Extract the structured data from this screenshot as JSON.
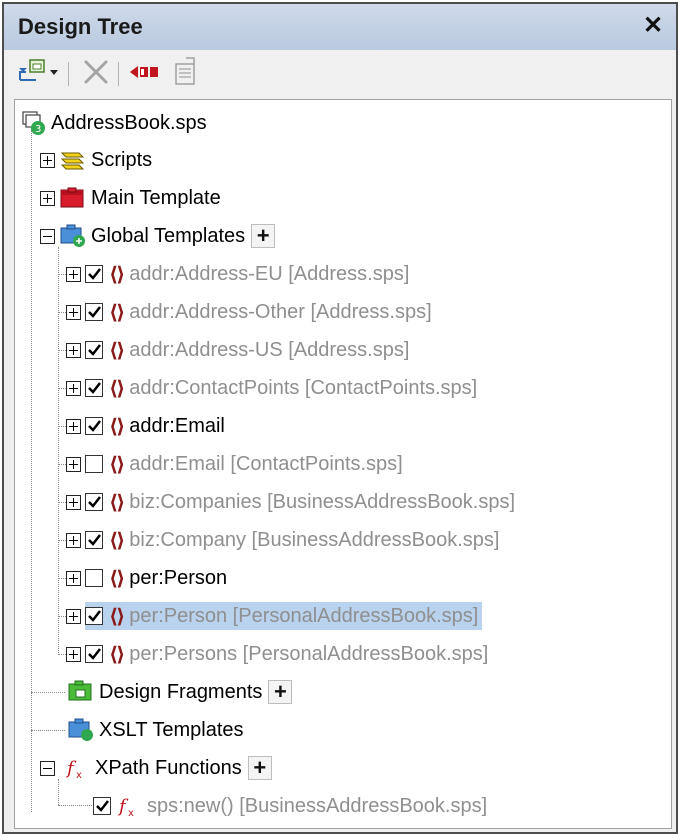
{
  "panel": {
    "title": "Design Tree",
    "close_glyph": "✕"
  },
  "toolbar": {
    "buttons": [
      {
        "name": "add-item-dropdown-button",
        "icon": "add-item-icon"
      },
      {
        "name": "delete-button",
        "icon": "delete-icon"
      },
      {
        "name": "toggle-button",
        "icon": "toggle-icon"
      },
      {
        "name": "properties-button",
        "icon": "properties-icon"
      }
    ]
  },
  "tree": {
    "root": {
      "label": "AddressBook.sps"
    },
    "scripts": {
      "label": "Scripts"
    },
    "main_template": {
      "label": "Main Template"
    },
    "global_templates": {
      "label": "Global Templates",
      "add_glyph": "+",
      "items": [
        {
          "label": "addr:Address-EU [Address.sps]",
          "checked": true,
          "active": false
        },
        {
          "label": "addr:Address-Other [Address.sps]",
          "checked": true,
          "active": false
        },
        {
          "label": "addr:Address-US [Address.sps]",
          "checked": true,
          "active": false
        },
        {
          "label": "addr:ContactPoints [ContactPoints.sps]",
          "checked": true,
          "active": false
        },
        {
          "label": "addr:Email",
          "checked": true,
          "active": true
        },
        {
          "label": "addr:Email [ContactPoints.sps]",
          "checked": false,
          "active": false
        },
        {
          "label": "biz:Companies [BusinessAddressBook.sps]",
          "checked": true,
          "active": false
        },
        {
          "label": "biz:Company [BusinessAddressBook.sps]",
          "checked": true,
          "active": false
        },
        {
          "label": "per:Person",
          "checked": false,
          "active": true
        },
        {
          "label": "per:Person [PersonalAddressBook.sps]",
          "checked": true,
          "active": false,
          "selected": true
        },
        {
          "label": "per:Persons [PersonalAddressBook.sps]",
          "checked": true,
          "active": false
        }
      ]
    },
    "design_fragments": {
      "label": "Design Fragments",
      "add_glyph": "+"
    },
    "xslt_templates": {
      "label": "XSLT Templates"
    },
    "xpath_functions": {
      "label": "XPath Functions",
      "add_glyph": "+",
      "items": [
        {
          "label": "sps:new() [BusinessAddressBook.sps]",
          "checked": true
        }
      ]
    }
  },
  "colors": {
    "title_bar": "#c5d3e6",
    "selection": "#b9d2ee",
    "inactive_text": "#8f8f8f",
    "template_brace": "#8b1a1a"
  }
}
